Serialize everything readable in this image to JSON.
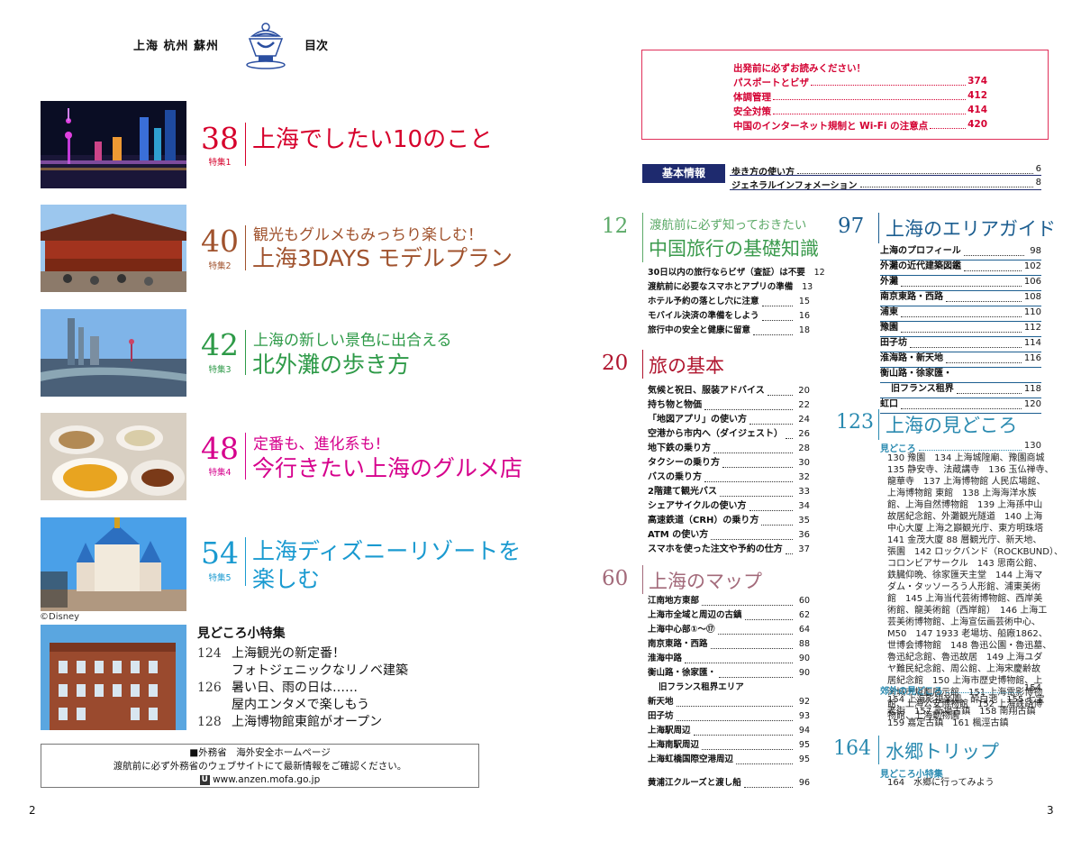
{
  "header": {
    "cities": "上海 杭州 蘇州",
    "title": "目次"
  },
  "left": {
    "features": [
      {
        "num": "38",
        "tag": "特集1",
        "title": "上海でしたい10のこと",
        "color": "#d6002b"
      },
      {
        "num": "40",
        "tag": "特集2",
        "sub": "観光もグルメもみっちり楽しむ！",
        "title": "上海3DAYS モデルプラン",
        "color": "#a0522d"
      },
      {
        "num": "42",
        "tag": "特集3",
        "sub": "上海の新しい景色に出合える",
        "title": "北外灘の歩き方",
        "color": "#2e9a48"
      },
      {
        "num": "48",
        "tag": "特集4",
        "sub": "定番も、進化系も!",
        "title": "今行きたい上海のグルメ店",
        "color": "#d6008c"
      },
      {
        "num": "54",
        "tag": "特集5",
        "title": "上海ディズニーリゾートを",
        "title2": "楽しむ",
        "color": "#1a9ad0"
      }
    ],
    "disney_credit": "©Disney",
    "mini": {
      "heading": "見どころ小特集",
      "items": [
        {
          "num": "124",
          "line1": "上海観光の新定番！",
          "line2": "フォトジェニックなリノベ建築"
        },
        {
          "num": "126",
          "line1": "暑い日、雨の日は……",
          "line2": "屋内エンタメで楽しもう"
        },
        {
          "num": "128",
          "line1": "上海博物館東館がオープン"
        }
      ]
    },
    "safety": {
      "line1": "■外務省　海外安全ホームページ",
      "line2": "渡航前に必ず外務省のウェブサイトにて最新情報をご確認ください。",
      "icon": "U",
      "url": "www.anzen.mofa.go.jp"
    },
    "page_num": "2"
  },
  "right": {
    "notice": {
      "heading": "出発前に必ずお読みください！",
      "items": [
        {
          "label": "パスポートとビザ",
          "page": "374"
        },
        {
          "label": "体調管理",
          "page": "412"
        },
        {
          "label": "安全対策",
          "page": "414"
        },
        {
          "label": "中国のインターネット規制と Wi-Fi の注意点",
          "page": "420"
        }
      ]
    },
    "basic": {
      "label": "基本情報",
      "items": [
        {
          "label": "歩き方の使い方",
          "page": "6"
        },
        {
          "label": "ジェネラルインフォメーション",
          "page": "8"
        }
      ]
    },
    "sec12": {
      "num": "12",
      "sub": "渡航前に必ず知っておきたい",
      "title": "中国旅行の基礎知識",
      "items": [
        {
          "label": "30日以内の旅行ならビザ（査証）は不要",
          "page": "12"
        },
        {
          "label": "渡航前に必要なスマホとアプリの準備",
          "page": "13"
        },
        {
          "label": "ホテル予約の落とし穴に注意",
          "page": "15"
        },
        {
          "label": "モバイル決済の準備をしよう",
          "page": "16"
        },
        {
          "label": "旅行中の安全と健康に留意",
          "page": "18"
        }
      ]
    },
    "sec20": {
      "num": "20",
      "title": "旅の基本",
      "items": [
        {
          "label": "気候と祝日、服装アドバイス",
          "page": "20"
        },
        {
          "label": "持ち物と物価",
          "page": "22"
        },
        {
          "label": "「地図アプリ」の使い方",
          "page": "24"
        },
        {
          "label": "空港から市内へ（ダイジェスト）",
          "page": "26"
        },
        {
          "label": "地下鉄の乗り方",
          "page": "28"
        },
        {
          "label": "タクシーの乗り方",
          "page": "30"
        },
        {
          "label": "バスの乗り方",
          "page": "32"
        },
        {
          "label": "2階建て観光バス",
          "page": "33"
        },
        {
          "label": "シェアサイクルの使い方",
          "page": "34"
        },
        {
          "label": "高速鉄道（CRH）の乗り方",
          "page": "35"
        },
        {
          "label": "ATM の使い方",
          "page": "36"
        },
        {
          "label": "スマホを使った注文や予約の仕方",
          "page": "37"
        }
      ]
    },
    "sec60": {
      "num": "60",
      "title": "上海のマップ",
      "items": [
        {
          "label": "江南地方東部",
          "page": "60"
        },
        {
          "label": "上海市全域と周辺の古鎮",
          "page": "62"
        },
        {
          "label": "上海中心部①～⑰",
          "page": "64"
        },
        {
          "label": "南京東路・西路",
          "page": "88"
        },
        {
          "label": "淮海中路",
          "page": "90"
        },
        {
          "label": "衡山路・徐家匯・",
          "page": "90"
        },
        {
          "label": "旧フランス租界エリア",
          "page": ""
        },
        {
          "label": "新天地",
          "page": "92"
        },
        {
          "label": "田子坊",
          "page": "93"
        },
        {
          "label": "上海駅周辺",
          "page": "94"
        },
        {
          "label": "上海南駅周辺",
          "page": "95"
        },
        {
          "label": "上海虹橋国際空港周辺",
          "page": "95"
        }
      ],
      "extra": {
        "label": "黄浦江クルーズと渡し船",
        "page": "96"
      }
    },
    "sec97": {
      "num": "97",
      "title": "上海のエリアガイド",
      "items": [
        {
          "label": "上海のプロフィール",
          "page": "98"
        },
        {
          "label": "外灘の近代建築図鑑",
          "page": "102"
        },
        {
          "label": "外灘",
          "page": "106"
        },
        {
          "label": "南京東路・西路",
          "page": "108"
        },
        {
          "label": "浦東",
          "page": "110"
        },
        {
          "label": "豫園",
          "page": "112"
        },
        {
          "label": "田子坊",
          "page": "114"
        },
        {
          "label": "淮海路・新天地",
          "page": "116"
        },
        {
          "label": "衡山路・徐家匯・",
          "page": ""
        },
        {
          "label": "旧フランス租界",
          "page": "118"
        },
        {
          "label": "虹口",
          "page": "120"
        }
      ]
    },
    "sec123": {
      "num": "123",
      "title": "上海の見どころ",
      "h1": {
        "label": "見どころ",
        "page": "130"
      },
      "desc1": [
        "130 豫園　134 上海城隍廟、豫園商城",
        "135 静安寺、法蔵講寺　136 玉仏禅寺、",
        "龍華寺　137 上海博物館 人民広場館、",
        "上海博物館 東館　138 上海海洋水族",
        "館、上海自然博物館　139 上海孫中山",
        "故居紀念館、外灘観光隧道　140 上海",
        "中心大厦 上海之巓観光庁、東方明珠塔",
        "141 金茂大廈 88 層観光庁、新天地、",
        "張園　142 ロックバンド（ROCKBUND）、",
        "コロンビアサークル　143 思南公館、",
        "鉄臓仰晩、徐家匯天主堂　144 上海マ",
        "ダム・タッソーろう人形館、浦東美術",
        "館　145 上海当代芸術博物館、西岸美",
        "術館、龍美術館（西岸館）　146 上海工",
        "芸美術博物館、上海宣伝画芸術中心、",
        "M50　147 1933 老場坊、船廠1862、",
        "世博会博物館　148 魯迅公園・魯迅墓、",
        "魯迅紀念館、魯迅故居　149 上海ユダ",
        "ヤ難民紀念館、周公館、上海宋慶齢故",
        "居紀念館　150 上海市歴史博物館、上",
        "海城市規劃展示館　151 上海電影博物",
        "館、上海公安博物館　152 上海鉄路博",
        "物館、上海動物園"
      ],
      "h2": {
        "label": "郊外の見どころ",
        "page": "154"
      },
      "desc2": [
        "154 上海影視楽園、酔白池　155 七宝",
        "老街　157 新場古鎮　158 南翔古鎮",
        "159 嘉定古鎮　161 楓涇古鎮"
      ]
    },
    "sec164": {
      "num": "164",
      "title": "水郷トリップ",
      "h1": "見どころ小特集",
      "desc": "164　水郷に行ってみよう"
    },
    "page_num": "3"
  }
}
